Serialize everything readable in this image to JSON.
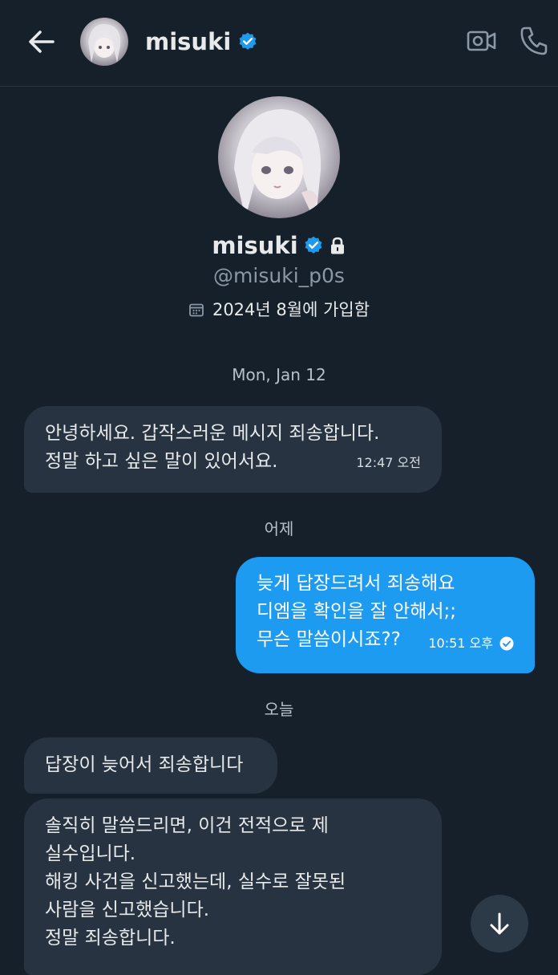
{
  "header": {
    "name": "misuki",
    "back_icon": "arrow-left-icon",
    "video_icon": "video-camera-icon",
    "call_icon": "phone-icon"
  },
  "profile": {
    "name": "misuki",
    "handle": "@misuki_p0s",
    "joined": "2024년 8월에 가입함"
  },
  "colors": {
    "background": "#15202b",
    "incoming_bubble": "#273340",
    "outgoing_bubble": "#1d9bf0",
    "verified": "#1d9bf0"
  },
  "conversation": [
    {
      "type": "date",
      "label": "Mon, Jan 12"
    },
    {
      "type": "message",
      "direction": "in",
      "lines": [
        "안녕하세요. 갑작스러운 메시지 죄송합니다.",
        "정말 하고 싶은 말이 있어서요."
      ],
      "time": "12:47 오전"
    },
    {
      "type": "date",
      "label": "어제"
    },
    {
      "type": "message",
      "direction": "out",
      "lines": [
        "늦게 답장드려서 죄송해요",
        "디엠을 확인을 잘 안해서;;",
        "무슨 말씀이시죠??"
      ],
      "time": "10:51 오후",
      "status": "read"
    },
    {
      "type": "date",
      "label": "오늘"
    },
    {
      "type": "message",
      "direction": "in",
      "lines": [
        "답장이 늦어서 죄송합니다"
      ]
    },
    {
      "type": "message",
      "direction": "in",
      "lines": [
        "솔직히 말씀드리면, 이건 전적으로 제",
        "실수입니다.",
        "해킹 사건을 신고했는데, 실수로 잘못된",
        "사람을 신고했습니다.",
        "정말 죄송합니다."
      ]
    }
  ]
}
